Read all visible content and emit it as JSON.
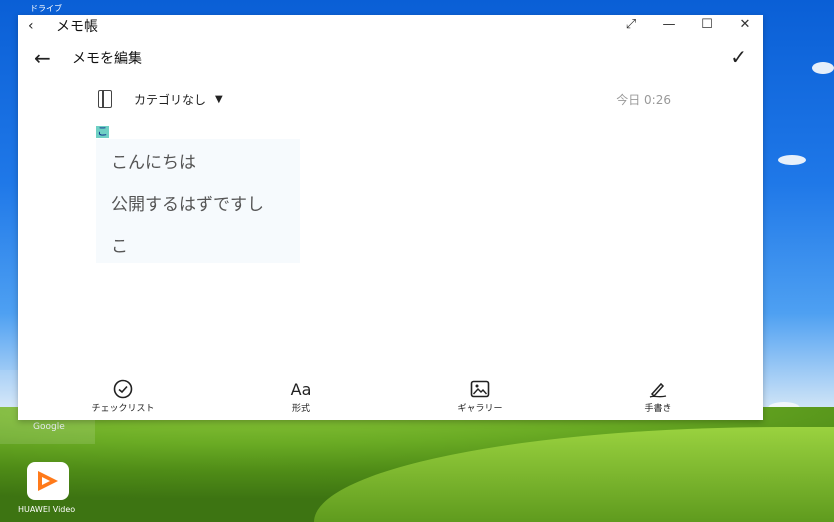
{
  "desktop": {
    "top_label": "ドライブ",
    "google_label": "Google",
    "video_app_label": "HUAWEI Video"
  },
  "window": {
    "title": "メモ帳",
    "controls": [
      "expand-icon",
      "minimize-icon",
      "maximize-icon",
      "close-icon"
    ]
  },
  "header": {
    "title": "メモを編集"
  },
  "category": {
    "label": "カテゴリなし",
    "date": "今日 0:26"
  },
  "editor": {
    "cursor_char": "こ",
    "lines": [
      "こんにちは",
      "公開するはずですし",
      "こ"
    ]
  },
  "toolbar": {
    "items": [
      {
        "label": "チェックリスト",
        "icon": "checklist-icon"
      },
      {
        "label": "形式",
        "icon": "format-icon",
        "glyph": "Aa"
      },
      {
        "label": "ギャラリー",
        "icon": "gallery-icon"
      },
      {
        "label": "手書き",
        "icon": "handwriting-icon"
      }
    ]
  }
}
